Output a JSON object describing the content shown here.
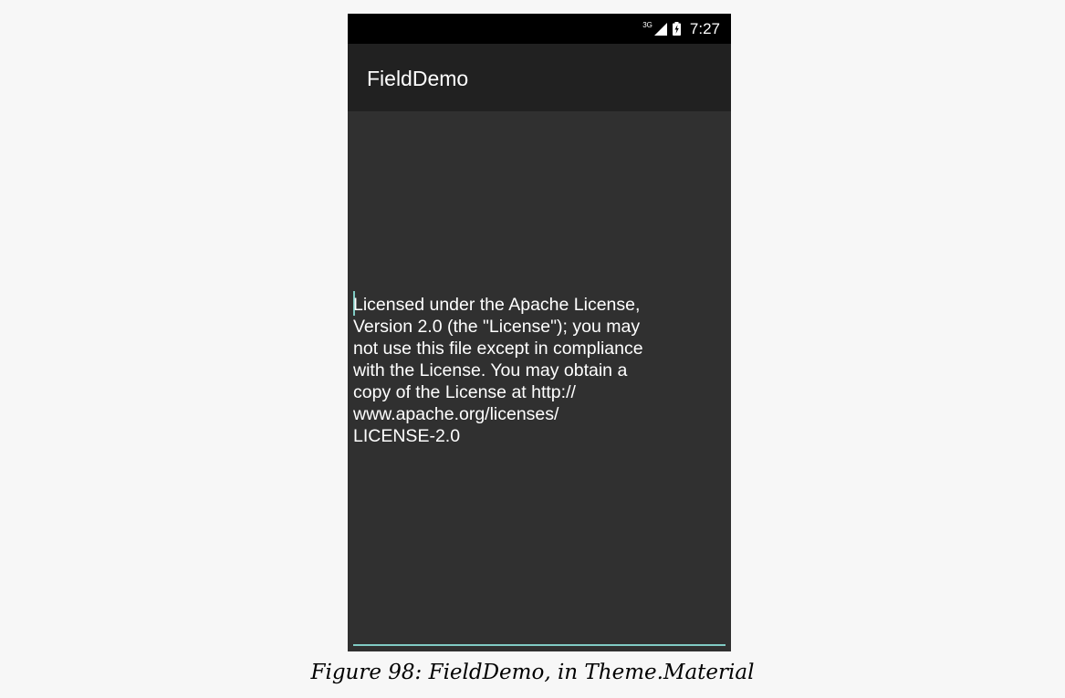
{
  "status_bar": {
    "network_label": "3G",
    "signal_icon": "signal-icon",
    "battery_icon": "battery-charging-icon",
    "time": "7:27"
  },
  "action_bar": {
    "title": "FieldDemo"
  },
  "field": {
    "text": "Licensed under the Apache License,\nVersion 2.0 (the \"License\"); you may\nnot use this file except in compliance\nwith the License. You may obtain a\ncopy of the License at http://\nwww.apache.org/licenses/\nLICENSE-2.0"
  },
  "caption": "Figure 98: FieldDemo, in Theme.Material",
  "colors": {
    "status_bar": "#000000",
    "action_bar": "#212121",
    "background": "#303030",
    "accent": "#80cbc4",
    "page": "#f7f7f7"
  }
}
